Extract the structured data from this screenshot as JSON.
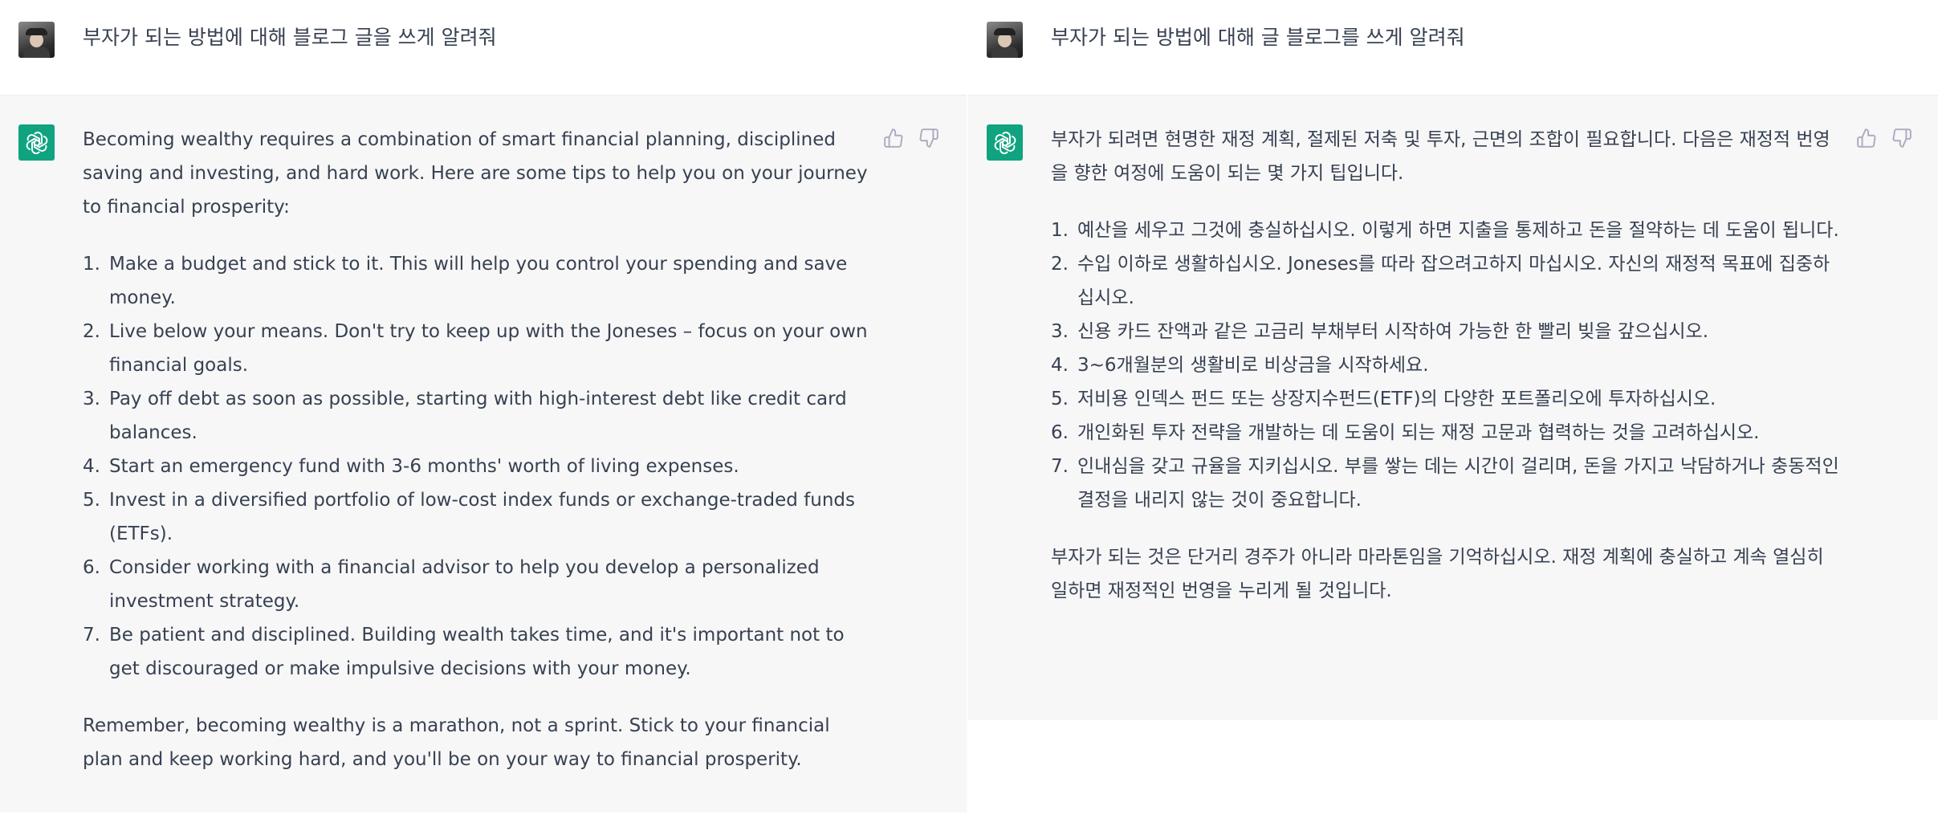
{
  "left": {
    "user_message": "부자가 되는 방법에 대해 블로그 글을 쓰게 알려줘",
    "intro": "Becoming wealthy requires a combination of smart financial planning, disciplined saving and investing, and hard work. Here are some tips to help you on your journey to financial prosperity:",
    "tips": [
      {
        "num": "1.",
        "text": "Make a budget and stick to it. This will help you control your spending and save money."
      },
      {
        "num": "2.",
        "text": "Live below your means. Don't try to keep up with the Joneses – focus on your own financial goals."
      },
      {
        "num": "3.",
        "text": "Pay off debt as soon as possible, starting with high-interest debt like credit card balances."
      },
      {
        "num": "4.",
        "text": "Start an emergency fund with 3-6 months' worth of living expenses."
      },
      {
        "num": "5.",
        "text": "Invest in a diversified portfolio of low-cost index funds or exchange-traded funds (ETFs)."
      },
      {
        "num": "6.",
        "text": "Consider working with a financial advisor to help you develop a personalized investment strategy."
      },
      {
        "num": "7.",
        "text": "Be patient and disciplined. Building wealth takes time, and it's important not to get discouraged or make impulsive decisions with your money."
      }
    ],
    "outro": "Remember, becoming wealthy is a marathon, not a sprint. Stick to your financial plan and keep working hard, and you'll be on your way to financial prosperity."
  },
  "right": {
    "user_message": "부자가 되는 방법에 대해 글 블로그를 쓰게 알려줘",
    "intro": "부자가 되려면 현명한 재정 계획, 절제된 저축 및 투자, 근면의 조합이 필요합니다. 다음은 재정적 번영을 향한 여정에 도움이 되는 몇 가지 팁입니다.",
    "tips": [
      {
        "num": "1.",
        "text": "예산을 세우고 그것에 충실하십시오. 이렇게 하면 지출을 통제하고 돈을 절약하는 데 도움이 됩니다."
      },
      {
        "num": "2.",
        "text": "수입 이하로 생활하십시오. Joneses를 따라 잡으려고하지 마십시오. 자신의 재정적 목표에 집중하십시오."
      },
      {
        "num": "3.",
        "text": "신용 카드 잔액과 같은 고금리 부채부터 시작하여 가능한 한 빨리 빚을 갚으십시오."
      },
      {
        "num": "4.",
        "text": "3~6개월분의 생활비로 비상금을 시작하세요."
      },
      {
        "num": "5.",
        "text": "저비용 인덱스 펀드 또는 상장지수펀드(ETF)의 다양한 포트폴리오에 투자하십시오."
      },
      {
        "num": "6.",
        "text": "개인화된 투자 전략을 개발하는 데 도움이 되는 재정 고문과 협력하는 것을 고려하십시오."
      },
      {
        "num": "7.",
        "text": "인내심을 갖고 규율을 지키십시오. 부를 쌓는 데는 시간이 걸리며, 돈을 가지고 낙담하거나 충동적인 결정을 내리지 않는 것이 중요합니다."
      }
    ],
    "outro": "부자가 되는 것은 단거리 경주가 아니라 마라톤임을 기억하십시오. 재정 계획에 충실하고 계속 열심히 일하면 재정적인 번영을 누리게 될 것입니다."
  },
  "icons": {
    "user_avatar": "user-avatar",
    "assistant_logo": "chatgpt-logo-icon",
    "like": "thumbs-up-icon",
    "dislike": "thumbs-down-icon"
  },
  "colors": {
    "assistant_bg": "#f7f7f8",
    "logo_green": "#10a37f",
    "text": "#374151"
  }
}
